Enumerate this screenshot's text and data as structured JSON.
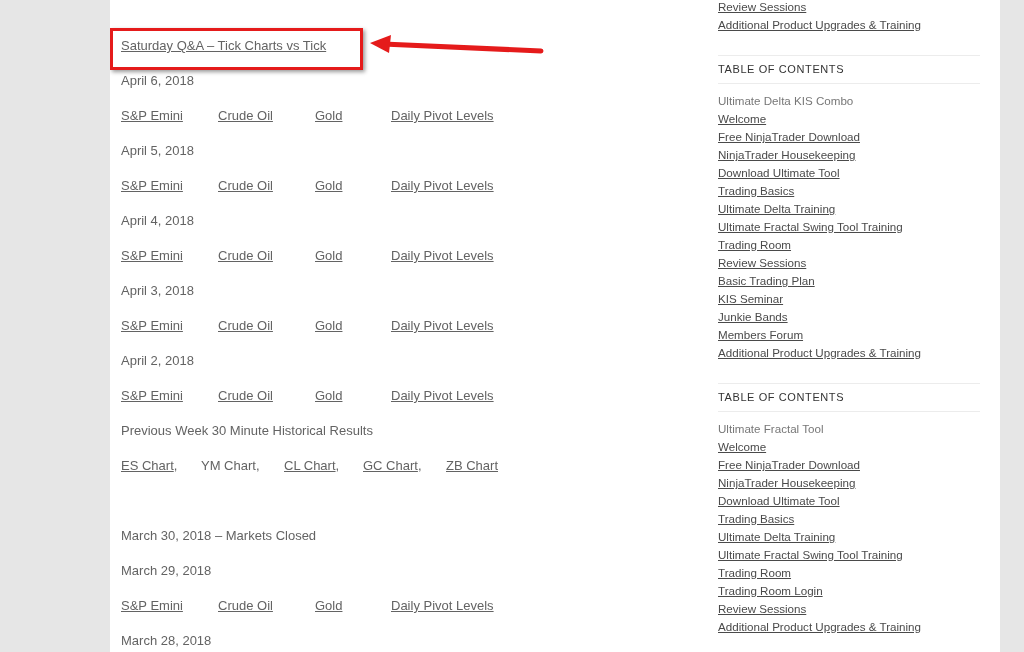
{
  "main": {
    "featured_link": "Saturday Q&A – Tick Charts vs Tick",
    "entries": [
      {
        "kind": "date",
        "text": "April 6, 2018"
      },
      {
        "kind": "links",
        "links": [
          "S&P Emini",
          "Crude Oil",
          "Gold",
          "Daily Pivot Levels"
        ]
      },
      {
        "kind": "date",
        "text": "April 5, 2018"
      },
      {
        "kind": "links",
        "links": [
          "S&P Emini",
          "Crude Oil",
          "Gold",
          "Daily Pivot Levels"
        ]
      },
      {
        "kind": "date",
        "text": "April 4, 2018"
      },
      {
        "kind": "links",
        "links": [
          "S&P Emini",
          "Crude Oil",
          "Gold",
          "Daily Pivot Levels"
        ]
      },
      {
        "kind": "date",
        "text": "April 3, 2018"
      },
      {
        "kind": "links",
        "links": [
          "S&P Emini",
          "Crude Oil",
          "Gold",
          "Daily Pivot Levels"
        ]
      },
      {
        "kind": "date",
        "text": "April 2, 2018"
      },
      {
        "kind": "links",
        "links": [
          "S&P Emini",
          "Crude Oil",
          "Gold",
          "Daily Pivot Levels"
        ]
      },
      {
        "kind": "date",
        "text": "Previous Week 30 Minute Historical Results"
      },
      {
        "kind": "charts",
        "items": [
          {
            "text": "ES Chart",
            "link": true,
            "suffix": ","
          },
          {
            "text": "YM Chart",
            "link": false,
            "suffix": ","
          },
          {
            "text": "CL Chart",
            "link": true,
            "suffix": ","
          },
          {
            "text": "GC Chart",
            "link": true,
            "suffix": ","
          },
          {
            "text": "ZB Chart",
            "link": true
          }
        ]
      },
      {
        "kind": "date",
        "text": "March 30, 2018 – Markets Closed"
      },
      {
        "kind": "date",
        "text": "March 29, 2018"
      },
      {
        "kind": "links",
        "links": [
          "S&P Emini",
          "Crude Oil",
          "Gold",
          "Daily Pivot Levels"
        ]
      },
      {
        "kind": "date",
        "text": "March 28, 2018"
      }
    ]
  },
  "sidebar": {
    "top_links": [
      "Review Sessions",
      "Additional Product Upgrades & Training"
    ],
    "sections": [
      {
        "heading": "TABLE OF CONTENTS",
        "subtitle": "Ultimate Delta KIS Combo",
        "links": [
          "Welcome",
          "Free NinjaTrader Download",
          "NinjaTrader Housekeeping",
          "Download Ultimate Tool",
          "Trading Basics",
          "Ultimate Delta Training",
          "Ultimate Fractal Swing Tool Training",
          "Trading Room",
          "Review Sessions",
          "Basic Trading Plan",
          "KIS Seminar",
          "Junkie Bands",
          "Members Forum",
          "Additional Product Upgrades & Training"
        ]
      },
      {
        "heading": "TABLE OF CONTENTS",
        "subtitle": "Ultimate Fractal Tool",
        "links": [
          "Welcome",
          "Free NinjaTrader Download",
          "NinjaTrader Housekeeping",
          "Download Ultimate Tool",
          "Trading Basics",
          "Ultimate Delta Training",
          "Ultimate Fractal Swing Tool Training",
          "Trading Room",
          "Trading Room Login",
          "Review Sessions",
          "Additional Product Upgrades & Training"
        ]
      }
    ]
  }
}
